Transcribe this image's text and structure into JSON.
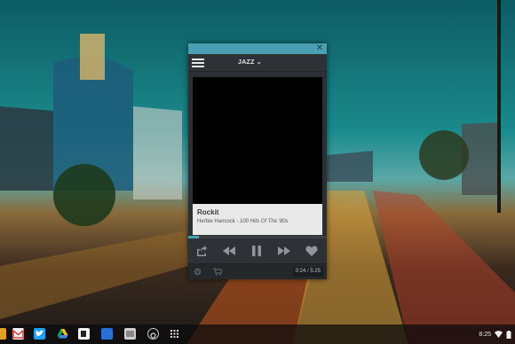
{
  "player": {
    "station": "JAZZ",
    "song_title": "Rockit",
    "artist": "Herbie Hancock",
    "separator": " - ",
    "album": "100 Hits Of The '80s",
    "time_display": "0:24 / 5:25",
    "progress_fraction": 0.074,
    "accent_color": "#4a9fb3"
  },
  "shelf": {
    "apps": [
      "app-launcher-partial",
      "gmail",
      "twitter",
      "google-drive",
      "notes",
      "blue-app",
      "gallery",
      "media-player",
      "app-grid"
    ],
    "clock": "8:25"
  }
}
